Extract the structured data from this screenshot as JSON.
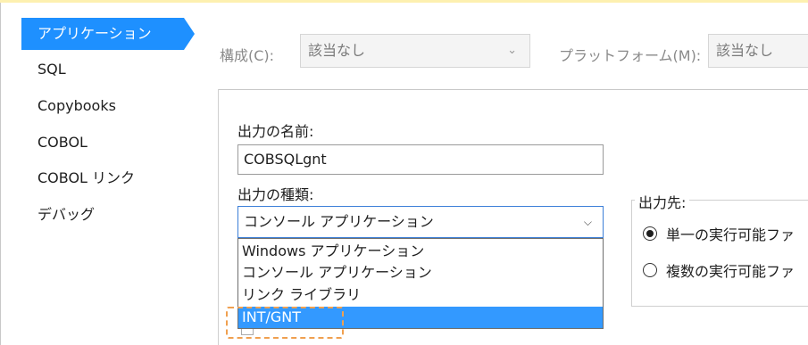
{
  "sidebar": {
    "items": [
      {
        "label": "アプリケーション",
        "selected": true
      },
      {
        "label": "SQL"
      },
      {
        "label": "Copybooks"
      },
      {
        "label": "COBOL"
      },
      {
        "label": "COBOL リンク"
      },
      {
        "label": "デバッグ"
      }
    ]
  },
  "toolbar": {
    "config_label": "構成(C):",
    "config_value": "該当なし",
    "platform_label": "プラットフォーム(M):",
    "platform_value": "該当なし"
  },
  "output": {
    "name_label": "出力の名前:",
    "name_value": "COBSQLgnt",
    "type_label": "出力の種類:",
    "type_value": "コンソール アプリケーション",
    "type_options": [
      "Windows アプリケーション",
      "コンソール アプリケーション",
      "リンク ライブラリ",
      "INT/GNT"
    ],
    "highlighted_option": "INT/GNT"
  },
  "destination": {
    "title": "出力先:",
    "options": [
      {
        "label": "単一の実行可能ファ",
        "selected": true
      },
      {
        "label": "複数の実行可能ファ",
        "selected": false
      }
    ]
  },
  "colors": {
    "accent": "#1e90ff",
    "highlight": "#3399ff",
    "hint_border": "#f0a050"
  }
}
